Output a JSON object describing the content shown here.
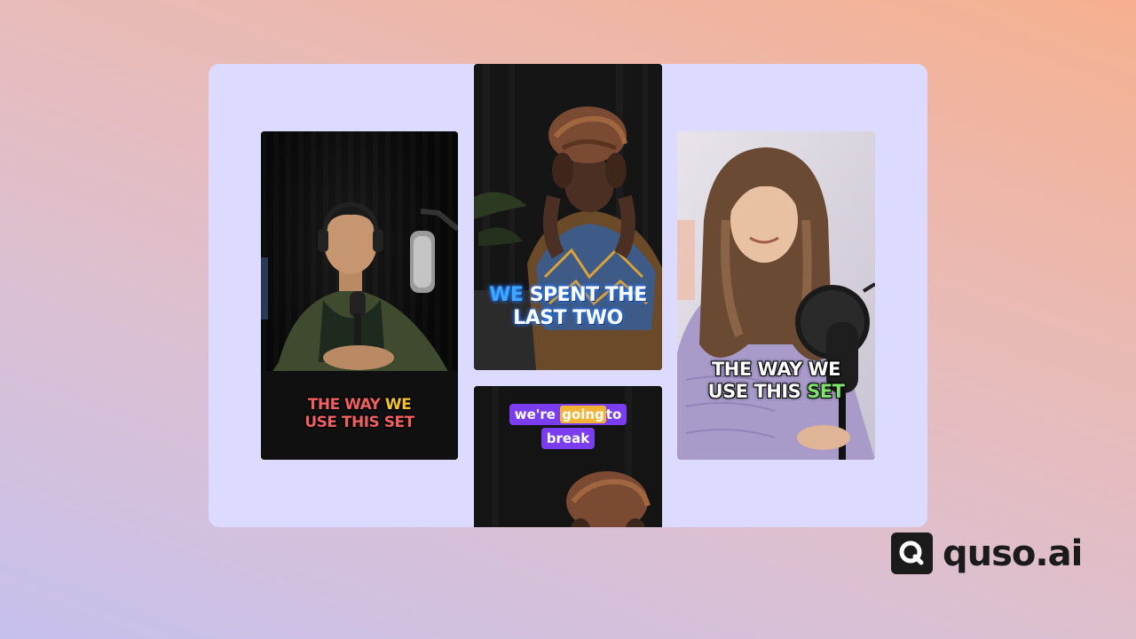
{
  "colors": {
    "panel": "#dcdaff",
    "caption1_main": "#f06060",
    "caption1_highlight": "#f2c230",
    "caption2_highlight": "#3aa8ff",
    "caption3_pill": "#7a3ef0",
    "caption3_highlight": "#f2b233",
    "caption4_highlight": "#7ee36a"
  },
  "cards": [
    {
      "caption": {
        "line1_pre": "THE WAY ",
        "line1_highlight": "WE",
        "line2": "USE THIS SET"
      }
    },
    {
      "caption": {
        "line1_highlight": "WE",
        "line1_post": " SPENT THE",
        "line2": "LAST TWO"
      }
    },
    {
      "caption": {
        "pill1_pre": "we're",
        "pill1_highlight": "going",
        "pill1_post": "to",
        "pill2": "break"
      }
    },
    {
      "caption": {
        "line1": "THE WAY WE",
        "line2_pre": "USE THIS ",
        "line2_highlight": "SET"
      }
    }
  ],
  "brand": {
    "icon": "quso-logo-icon",
    "name": "quso.ai"
  }
}
